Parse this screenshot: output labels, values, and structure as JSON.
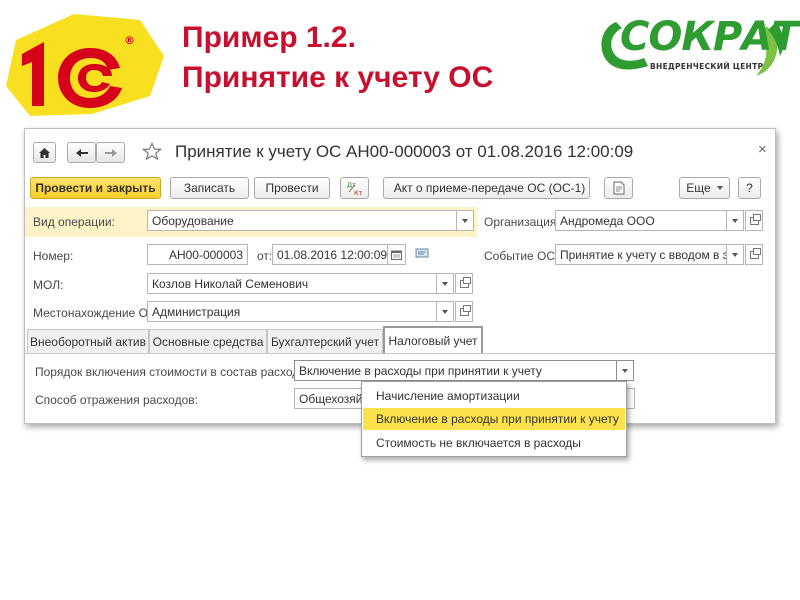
{
  "slide": {
    "title_line1": "Пример 1.2.",
    "title_line2": "Принятие к учету ОС",
    "logo_left": "1С",
    "logo_right_name": "СОКРАТ",
    "logo_right_sub": "ВНЕДРЕНЧЕСКИЙ ЦЕНТР"
  },
  "window": {
    "title": "Принятие к учету ОС АН00-000003 от 01.08.2016 12:00:09",
    "nav": {
      "home_icon": "home-icon",
      "back_icon": "arrow-left-icon",
      "forward_icon": "arrow-right-icon",
      "star_icon": "star-icon",
      "close": "×"
    },
    "toolbar": {
      "post_close": "Провести и закрыть",
      "save": "Записать",
      "post": "Провести",
      "dt_kt_icon": "Дт/Кт",
      "act": "Акт о приеме-передаче ОС (ОС-1)",
      "more": "Еще",
      "help": "?"
    },
    "form": {
      "operation_label": "Вид операции:",
      "operation_value": "Оборудование",
      "org_label": "Организация:",
      "org_value": "Андромеда ООО",
      "number_label": "Номер:",
      "number_value": "АН00-000003",
      "date_label": "от:",
      "date_value": "01.08.2016 12:00:09",
      "event_label": "Событие ОС:",
      "event_value": "Принятие к учету с вводом в экс",
      "mol_label": "МОЛ:",
      "mol_value": "Козлов Николай Семенович",
      "location_label": "Местонахождение ОС:",
      "location_value": "Администрация"
    },
    "tabs": [
      {
        "label": "Внеоборотный актив"
      },
      {
        "label": "Основные средства"
      },
      {
        "label": "Бухгалтерский учет"
      },
      {
        "label": "Налоговый учет"
      }
    ],
    "tax": {
      "order_label": "Порядок включения стоимости в состав расходов:",
      "order_value": "Включение в расходы при принятии к учету",
      "method_label": "Способ отражения расходов:",
      "method_value": "Общехозяйст"
    },
    "dropdown": {
      "options": [
        "Начисление амортизации",
        "Включение в расходы при принятии к учету",
        "Стоимость не включается в расходы"
      ],
      "selected": "Включение в расходы при принятии к учету"
    }
  },
  "colors": {
    "title_red": "#c8102e",
    "logo_yellow": "#f8e020",
    "logo_red": "#d7001a",
    "sokrat_green": "#2f9c32",
    "primary_button": "#f9cf2b",
    "highlight_band": "#fdf3c6",
    "dropdown_selected": "#fbe24d"
  }
}
